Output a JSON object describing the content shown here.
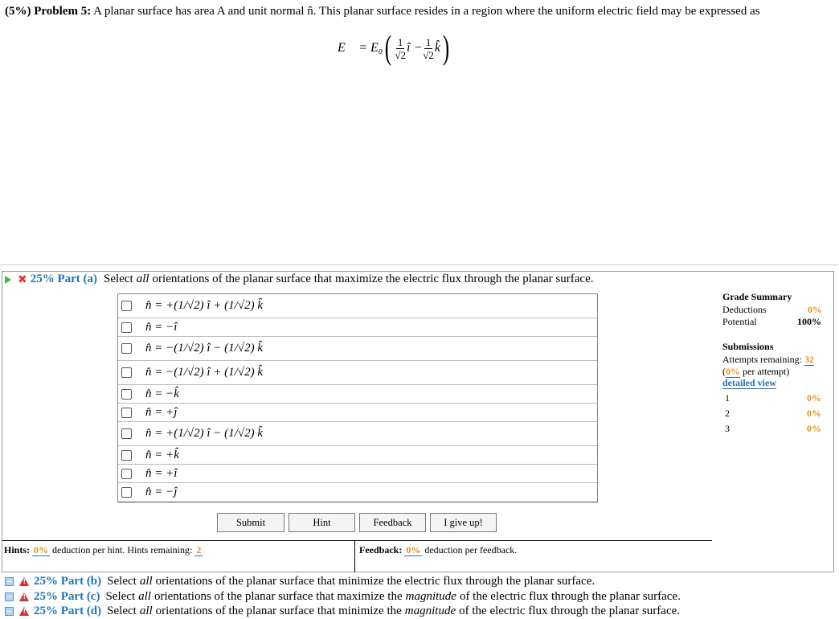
{
  "problem": {
    "weight": "(5%)",
    "label": "Problem 5:",
    "text": "A planar surface has area A and unit normal n̂. This planar surface resides in a region where the uniform electric field may be expressed as",
    "equation_lhs": "E⃗ = E₀",
    "equation_i": "î −",
    "equation_k": "k̂"
  },
  "part_a": {
    "percent": "25% Part (a)",
    "prompt_pre": "Select",
    "prompt_em": "all",
    "prompt_post": "orientations of the planar surface that maximize the electric flux through the planar surface."
  },
  "options": [
    "n̂ = +(1/√2) î + (1/√2) k̂",
    "n̂ = −î",
    "n̂ = −(1/√2) î − (1/√2) k̂",
    "n̂ = −(1/√2) î + (1/√2) k̂",
    "n̂ = −k̂",
    "n̂ = +ĵ",
    "n̂ = +(1/√2) î − (1/√2) k̂",
    "n̂ = +k̂",
    "n̂ = +î",
    "n̂ = −ĵ"
  ],
  "buttons": {
    "submit": "Submit",
    "hint": "Hint",
    "feedback": "Feedback",
    "give_up": "I give up!"
  },
  "hints": {
    "label": "Hints:",
    "pct": "0%",
    "text": "deduction per hint. Hints remaining:",
    "remaining": "2"
  },
  "feedback": {
    "label": "Feedback:",
    "pct": "0%",
    "text": "deduction per feedback."
  },
  "grade_summary": {
    "title": "Grade Summary",
    "deductions_label": "Deductions",
    "deductions_value": "0%",
    "potential_label": "Potential",
    "potential_value": "100%",
    "submissions_title": "Submissions",
    "attempts_label": "Attempts remaining:",
    "attempts_value": "32",
    "per_attempt_pct": "0%",
    "per_attempt_text": "per attempt)",
    "detailed_view": "detailed view",
    "rows": [
      {
        "n": "1",
        "v": "0%"
      },
      {
        "n": "2",
        "v": "0%"
      },
      {
        "n": "3",
        "v": "0%"
      }
    ]
  },
  "other_parts": [
    {
      "percent": "25% Part (b)",
      "pre": "Select",
      "em": "all",
      "post": "orientations of the planar surface that minimize the electric flux through the planar surface.",
      "em2": "",
      "post2": ""
    },
    {
      "percent": "25% Part (c)",
      "pre": "Select",
      "em": "all",
      "post": "orientations of the planar surface that maximize the",
      "em2": "magnitude",
      "post2": "of the electric flux through the planar surface."
    },
    {
      "percent": "25% Part (d)",
      "pre": "Select",
      "em": "all",
      "post": "orientations of the planar surface that minimize the",
      "em2": "magnitude",
      "post2": "of the electric flux through the planar surface."
    }
  ]
}
